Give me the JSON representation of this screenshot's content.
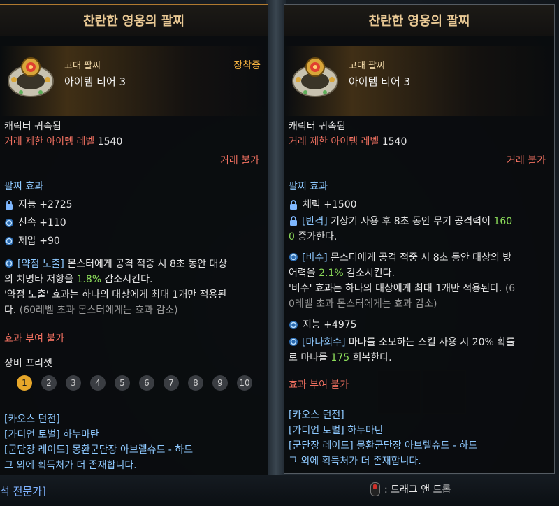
{
  "left": {
    "title": "찬란한 영웅의 팔찌",
    "grade": "고대 팔찌",
    "tier": "아이템 티어 3",
    "equipped": "장착중",
    "bound": "캐릭터 귀속됨",
    "trade_level_label": "거래 제한 아이템 레벨",
    "trade_level_value": "1540",
    "trade": "거래 불가",
    "effect_header": "팔찌 효과",
    "stats": [
      {
        "icon": "lock-icon",
        "text": "지능 +2725"
      },
      {
        "icon": "swirl-icon",
        "text": "신속 +110"
      },
      {
        "icon": "swirl-icon",
        "text": "제압 +90"
      }
    ],
    "special": {
      "tag": "[약점 노출]",
      "line1": " 몬스터에게 공격 적중 시 8초 동안 대상",
      "line2_pre": "의 치명타 저항을 ",
      "line2_val": "1.8%",
      "line2_post": " 감소시킨다.",
      "line3": "'약점 노출' 효과는 하나의 대상에게 최대 1개만 적용된",
      "line4_pre": "다. ",
      "line4_grey": "(60레벨 초과 몬스터에게는 효과 감소)"
    },
    "no_enhance": "효과 부여 불가",
    "preset_label": "장비 프리셋",
    "presets": [
      "1",
      "2",
      "3",
      "4",
      "5",
      "6",
      "7",
      "8",
      "9",
      "10"
    ],
    "sources": [
      {
        "tag": "[카오스 던전]",
        "text": ""
      },
      {
        "tag": "[가디언 토벌]",
        "text": " 하누마탄"
      },
      {
        "tag": "[군단장 레이드]",
        "text": " 몽환군단장 아브렐슈드 - 하드"
      }
    ],
    "more_sources": "그 외에 획득처가 더 존재합니다."
  },
  "right": {
    "title": "찬란한 영웅의 팔찌",
    "grade": "고대 팔찌",
    "tier": "아이템 티어 3",
    "bound": "캐릭터 귀속됨",
    "trade_level_label": "거래 제한 아이템 레벨",
    "trade_level_value": "1540",
    "trade": "거래 불가",
    "effect_header": "팔찌 효과",
    "stat1": "체력 +1500",
    "counter": {
      "tag": "[반격]",
      "line1": " 기상기 사용 후 8초 동안 무기 공격력이 ",
      "val_a": "160",
      "val_b": "0",
      "line2_post": " 증가한다."
    },
    "vital": {
      "tag": "[비수]",
      "line1": " 몬스터에게 공격 적중 시 8초 동안 대상의 방",
      "line2_pre": "어력을 ",
      "line2_val": "2.1%",
      "line2_post": " 감소시킨다.",
      "line3": "'비수' 효과는 하나의 대상에게 최대 1개만 적용된다. ",
      "line3_grey": "(6",
      "line4_grey": "0레벨 초과 몬스터에게는 효과 감소)"
    },
    "stat2": "지능 +4975",
    "mana": {
      "tag": "[마나회수]",
      "line1": " 마나를 소모하는 스킬 사용 시 20% 확률",
      "line2_pre": "로 마나를 ",
      "line2_val": "175",
      "line2_post": " 회복한다."
    },
    "no_enhance": "효과 부여 불가",
    "sources": [
      {
        "tag": "[카오스 던전]",
        "text": ""
      },
      {
        "tag": "[가디언 토벌]",
        "text": " 하누마탄"
      },
      {
        "tag": "[군단장 레이드]",
        "text": " 몽환군단장 아브렐슈드 - 하드"
      }
    ],
    "more_sources": "그 외에 획득처가 더 존재합니다."
  },
  "background": {
    "bottom_left": "석 전문가]",
    "drag_hint": ": 드래그 앤 드롭"
  },
  "colors": {
    "title": "#e8c894",
    "equipped": "#f2b040",
    "restricted": "#f07060",
    "source": "#8ec9ff",
    "value_green": "#8cdc5a",
    "preset_active": "#e7a72a"
  }
}
